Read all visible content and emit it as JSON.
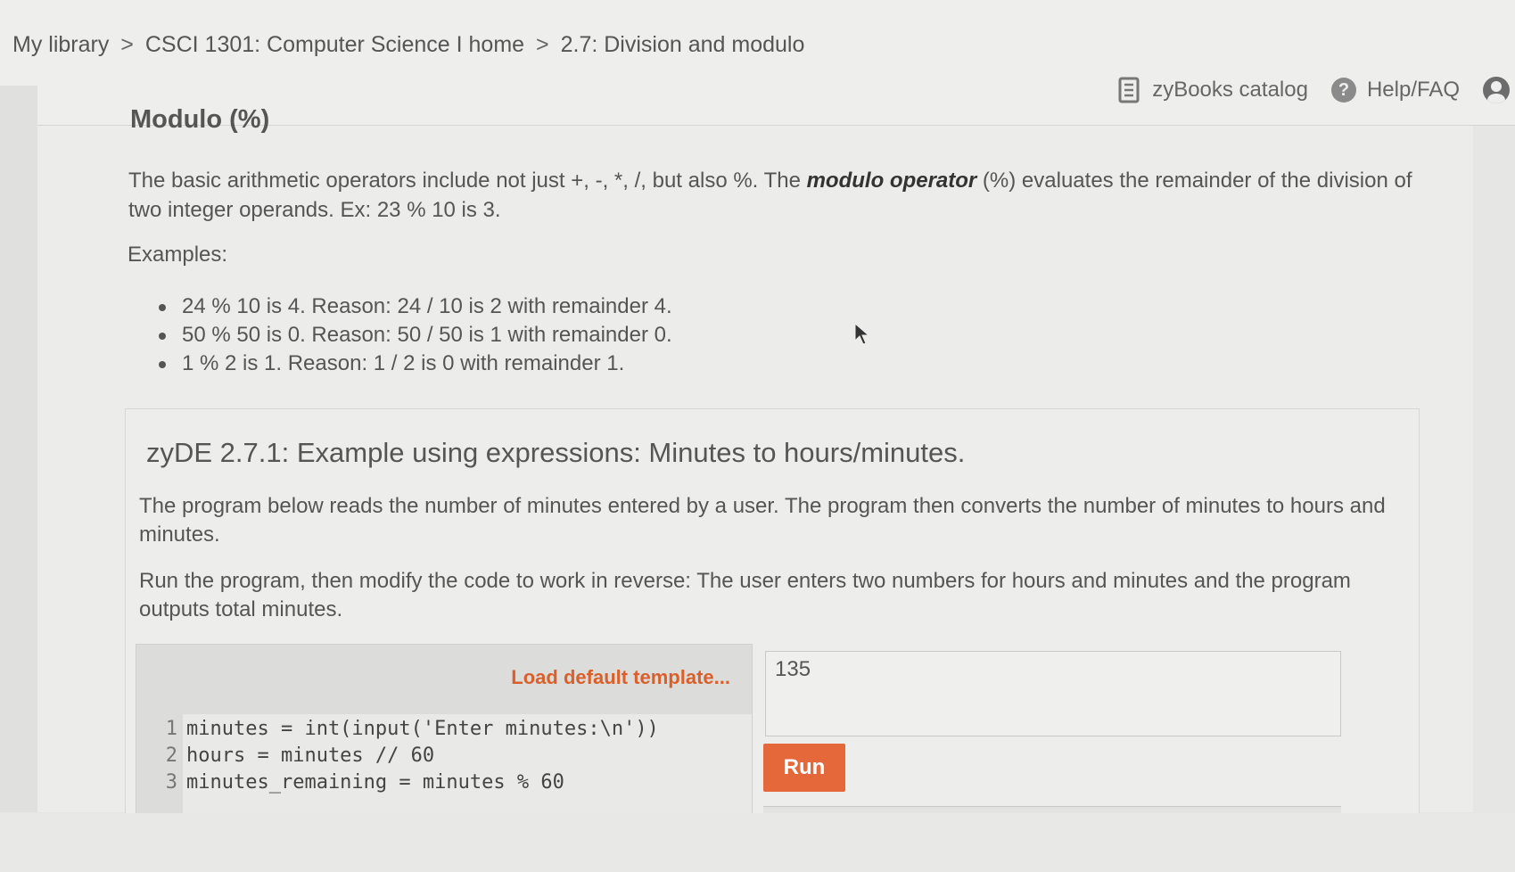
{
  "breadcrumb": {
    "items": [
      "My library",
      "CSCI 1301: Computer Science I home",
      "2.7: Division and modulo"
    ],
    "separator": ">"
  },
  "nav": {
    "catalog_label": "zyBooks catalog",
    "help_label": "Help/FAQ",
    "icons": [
      "book-icon",
      "help-icon",
      "user-icon"
    ]
  },
  "section": {
    "title": "Modulo (%)",
    "intro_part1": "The basic arithmetic operators include not just +, -, *, /, but also %. The ",
    "intro_bold": "modulo operator",
    "intro_part2": " (%) evaluates the remainder of the division of two integer operands. Ex: 23 % 10 is 3.",
    "examples_label": "Examples:",
    "examples": [
      "24 % 10 is 4. Reason: 24 / 10 is 2 with remainder 4.",
      "50 % 50 is 0. Reason: 50 / 50 is 1 with remainder 0.",
      "1 % 2 is 1. Reason: 1 / 2 is 0 with remainder 1."
    ]
  },
  "zyde": {
    "title": "zyDE 2.7.1: Example using expressions: Minutes to hours/minutes.",
    "para1": "The program below reads the number of minutes entered by a user. The program then converts the number of minutes to hours and minutes.",
    "para2": "Run the program, then modify the code to work in reverse: The user enters two numbers for hours and minutes and the program outputs total minutes.",
    "load_template_label": "Load default template...",
    "code_lines": [
      {
        "num": "1",
        "text": "minutes = int(input('Enter minutes:\\n'))"
      },
      {
        "num": "2",
        "text": "hours = minutes // 60"
      },
      {
        "num": "3",
        "text": "minutes_remaining = minutes % 60"
      }
    ],
    "input_value": "135",
    "run_label": "Run"
  },
  "colors": {
    "accent": "#e5683a",
    "template_link": "#d9602a"
  }
}
